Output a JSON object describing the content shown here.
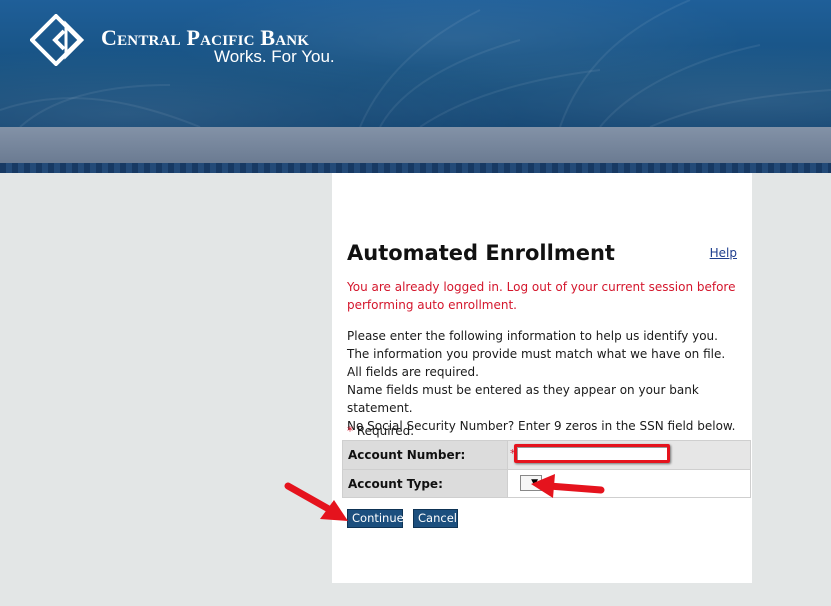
{
  "brand": {
    "name": "Central Pacific Bank",
    "tagline": "Works. For You."
  },
  "page": {
    "title": "Automated Enrollment",
    "help_label": "Help",
    "error_message": "You are already logged in. Log out of your current session before performing auto enrollment.",
    "instructions": [
      "Please enter the following information to help us identify you. The information you provide must match what we have on file. All fields are required.",
      "Name fields must be entered as they appear on your bank statement.",
      "No Social Security Number? Enter 9 zeros in the SSN field below."
    ],
    "required_star": "*",
    "required_label": "Required."
  },
  "form": {
    "account_number_label": "Account Number:",
    "account_number_value": "",
    "account_type_label": "Account Type:",
    "account_type_selected": "",
    "select_arrow": "▼"
  },
  "buttons": {
    "continue_label": "Continue",
    "cancel_label": "Cancel"
  },
  "colors": {
    "header_blue": "#16507f",
    "error_red": "#d4162c",
    "button_blue": "#1c4f7e",
    "annotation_red": "#e5131d"
  }
}
